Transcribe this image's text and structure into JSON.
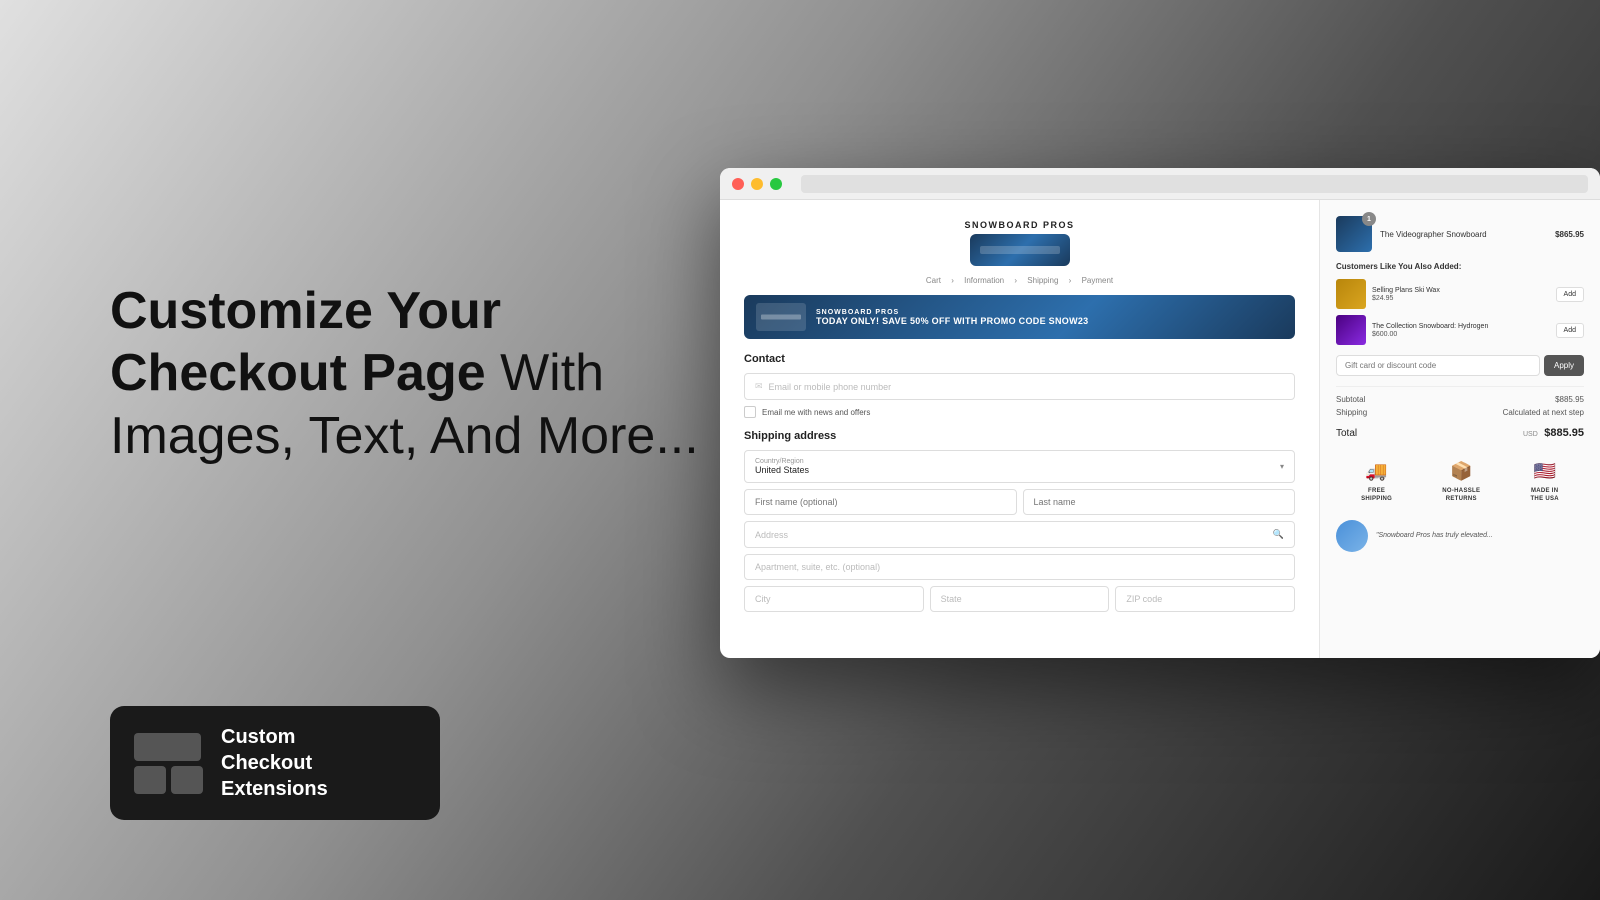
{
  "background": {
    "gradient": "linear-gradient(135deg, #e8e8e8 0%, #c0c0c0 30%, #888 60%, #333 80%, #111 100%)"
  },
  "hero": {
    "title_bold": "Customize Your Checkout Page",
    "title_normal": " With Images, Text, And More..."
  },
  "app_badge": {
    "name_line1": "Custom",
    "name_line2": "Checkout",
    "name_line3": "Extensions"
  },
  "browser": {
    "titlebar": {
      "dot1": "red",
      "dot2": "yellow",
      "dot3": "green"
    }
  },
  "checkout": {
    "store": {
      "name": "SNOWBOARD PROS"
    },
    "breadcrumb": {
      "cart": "Cart",
      "information": "Information",
      "shipping": "Shipping",
      "payment": "Payment"
    },
    "promo": {
      "store_name": "SNOWBOARD PROS",
      "text": "TODAY ONLY! SAVE 50% OFF WITH PROMO CODE SNOW23"
    },
    "contact": {
      "section_title": "Contact",
      "email_placeholder": "Email or mobile phone number",
      "newsletter_label": "Email me with news and offers"
    },
    "shipping": {
      "section_title": "Shipping address",
      "country_label": "Country/Region",
      "country_value": "United States",
      "first_name_placeholder": "First name (optional)",
      "last_name_placeholder": "Last name",
      "address_placeholder": "Address",
      "apt_placeholder": "Apartment, suite, etc. (optional)",
      "city_placeholder": "City",
      "state_placeholder": "State",
      "zip_placeholder": "ZIP code"
    },
    "order": {
      "item_name": "The Videographer Snowboard",
      "item_price": "$865.95",
      "item_qty": "1"
    },
    "also_bought": {
      "title": "Customers Like You Also Added:",
      "items": [
        {
          "name": "Selling Plans Ski Wax",
          "price": "$24.95",
          "type": "wax"
        },
        {
          "name": "The Collection Snowboard: Hydrogen",
          "price": "$600.00",
          "type": "board"
        }
      ],
      "add_label": "Add"
    },
    "gift_card": {
      "placeholder": "Gift card or discount code",
      "apply_label": "Apply"
    },
    "totals": {
      "subtotal_label": "Subtotal",
      "subtotal_value": "$885.95",
      "shipping_label": "Shipping",
      "shipping_value": "Calculated at next step",
      "total_label": "Total",
      "currency": "USD",
      "total_value": "$885.95"
    },
    "trust_badges": [
      {
        "label": "FREE SHIPPING",
        "icon": "🚚"
      },
      {
        "label": "NO-HASSLE RETURNS",
        "icon": "📦"
      },
      {
        "label": "MADE IN THE USA",
        "icon": "🇺🇸"
      }
    ],
    "testimonial": {
      "text": "\"Snowboard Pros has truly elevated..."
    }
  }
}
